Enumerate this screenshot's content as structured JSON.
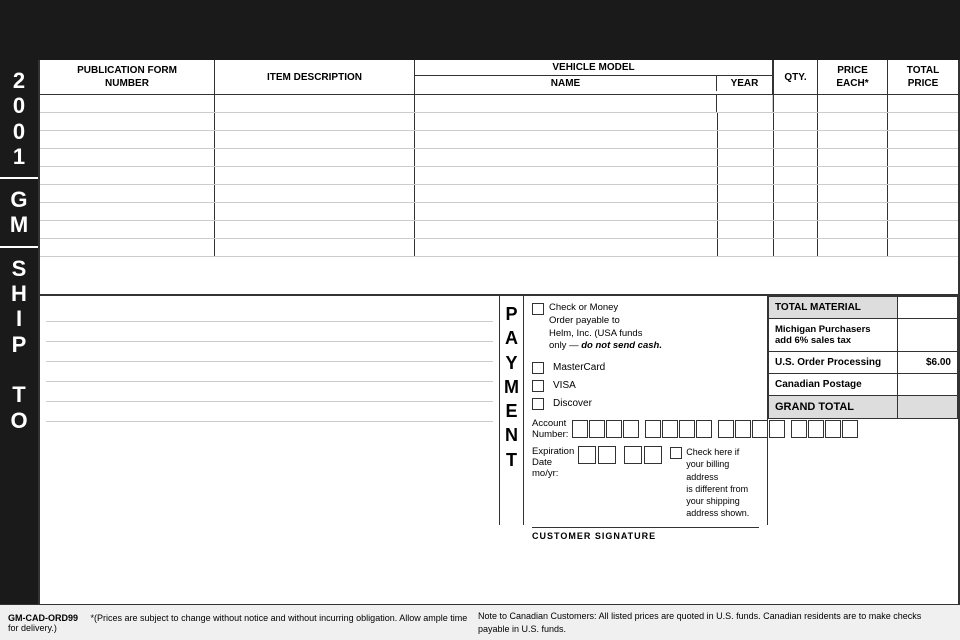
{
  "header": {
    "col_pub_number": "PUBLICATION FORM\nNUMBER",
    "col_item_desc": "ITEM DESCRIPTION",
    "col_vehicle_model": "VEHICLE MODEL",
    "col_vehicle_name": "NAME",
    "col_vehicle_year": "YEAR",
    "col_qty": "QTY.",
    "col_price_each": "PRICE\nEACH*",
    "col_total_price": "TOTAL\nPRICE"
  },
  "left_label": {
    "year": "2\n0\n0\n1",
    "brand": "G\nM",
    "ship_to": "S\nH\nI\nP\n\nT\nO"
  },
  "payment": {
    "label_letters": "P\nA\nY\nM\nE\nN\nT",
    "check_money_order": "Check or Money\nOrder payable to\nHelm, Inc. (USA funds\nonly — do not send cash.)",
    "mastercard": "MasterCard",
    "visa": "VISA",
    "discover": "Discover",
    "account_number_label": "Account\nNumber:",
    "expiration_label": "Expiration\nDate mo/yr:",
    "billing_check_text": "Check here if your billing address\nis different from your shipping\naddress shown.",
    "customer_signature_label": "CUSTOMER SIGNATURE"
  },
  "summary": {
    "total_material_label": "TOTAL MATERIAL",
    "michigan_label": "Michigan Purchasers\nadd 6% sales tax",
    "us_order_label": "U.S. Order Processing",
    "us_order_value": "$6.00",
    "canadian_postage_label": "Canadian Postage",
    "grand_total_label": "GRAND TOTAL"
  },
  "footer": {
    "form_code": "GM-CAD-ORD99",
    "asterisk_note": "*(Prices are subject to change without notice and without incurring obligation. Allow ample time for delivery.)",
    "canadian_note": "Note to Canadian Customers: All listed prices are quoted in U.S. funds. Canadian residents are to make checks payable in U.S. funds."
  }
}
